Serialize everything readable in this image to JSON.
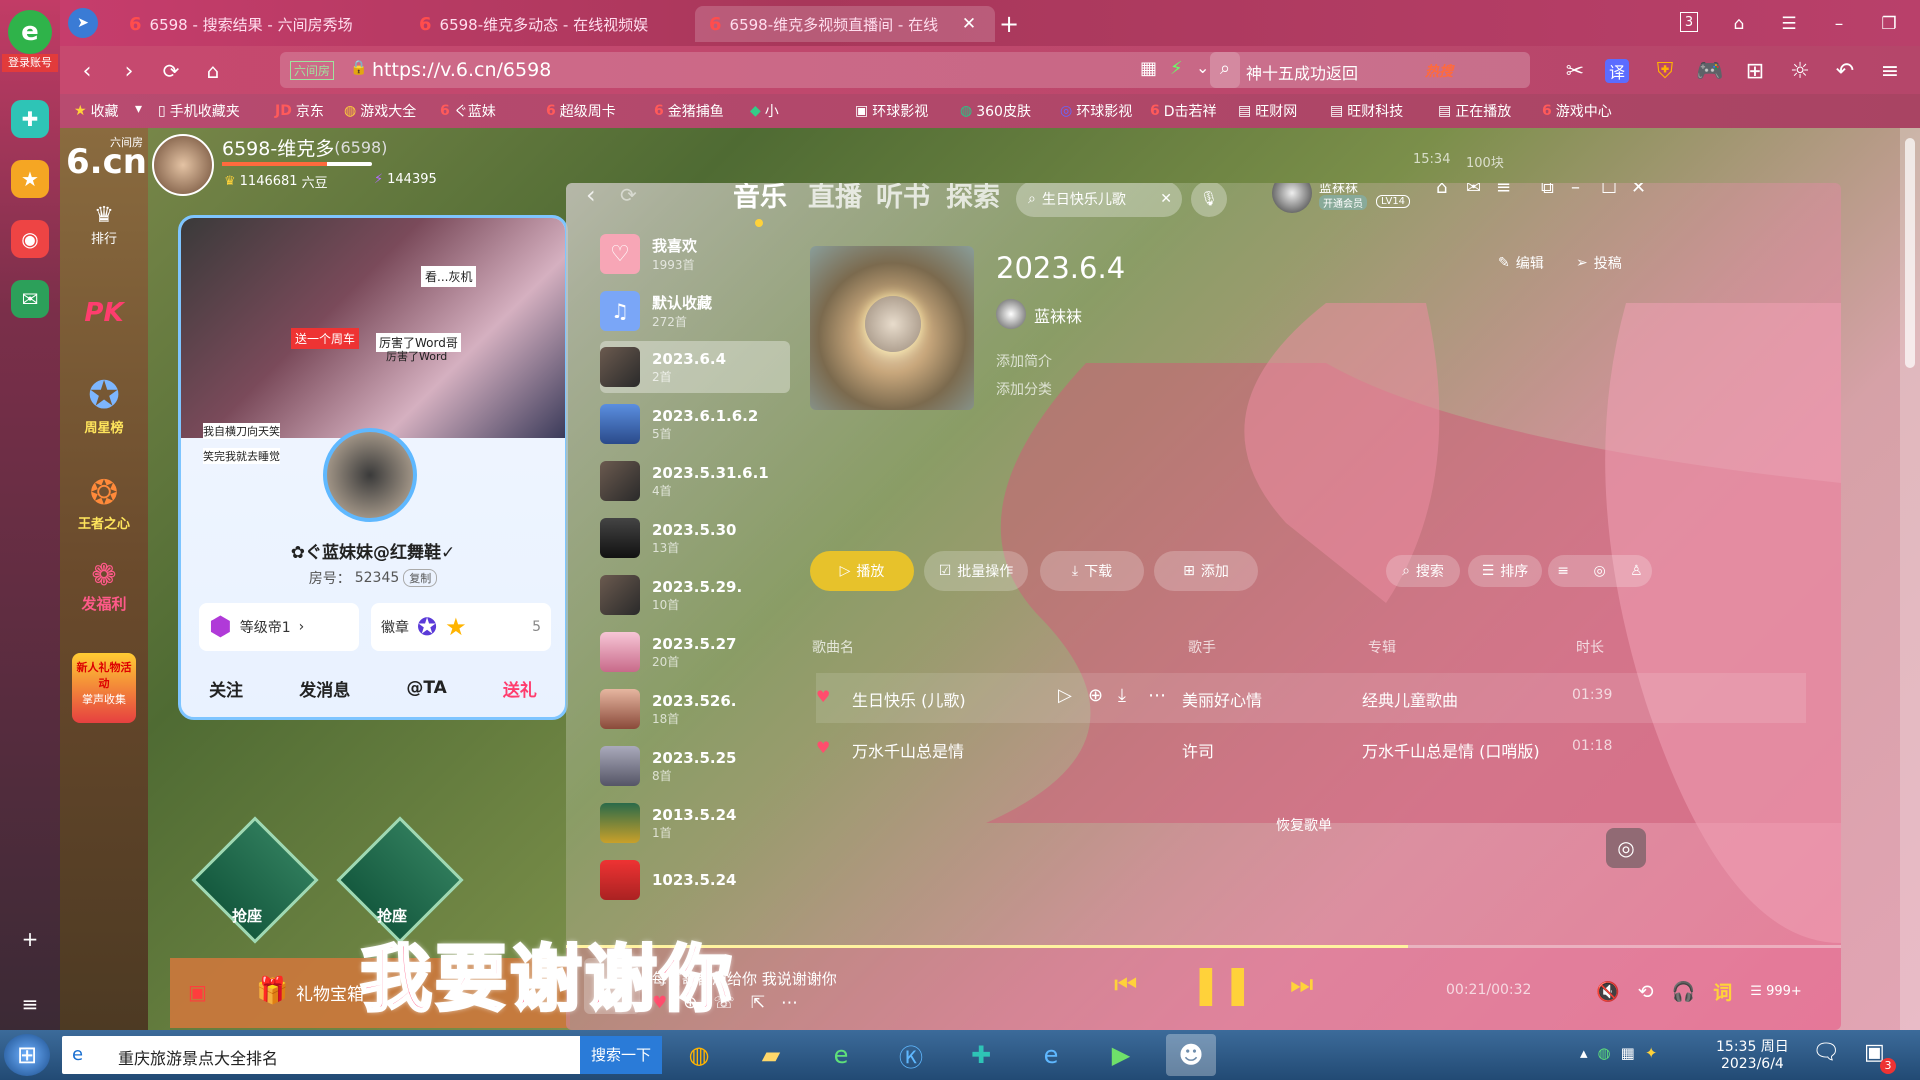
{
  "browser": {
    "login_label": "登录账号",
    "tabs": [
      {
        "label": "6598 - 搜索结果 - 六间房秀场"
      },
      {
        "label": "6598-维克多动态 - 在线视频娱"
      },
      {
        "label": "6598-维克多视频直播间 - 在线"
      }
    ],
    "tab_count": "3",
    "site_label": "六间房",
    "url": "https://v.6.cn/6598",
    "search_text": "神十五成功返回",
    "search_hot": "热搜",
    "bookmarks": [
      "收藏",
      "手机收藏夹",
      "京东",
      "游戏大全",
      "ぐ蓝妹",
      "超级周卡",
      "金猪捕鱼",
      "小",
      "环球影视",
      "360皮肤",
      "环球影视",
      "D击若祥",
      "旺财网",
      "旺财科技",
      "正在播放",
      "游戏中心"
    ]
  },
  "site": {
    "logo_sub": "六间房",
    "logo_main": "6.cn",
    "side_items": [
      "排行",
      "PK",
      "周星榜",
      "王者之心",
      "发福利",
      "新人礼物活动",
      "掌声收集"
    ],
    "host_name": "6598-维克多",
    "host_id": "(6598)",
    "beans": "1146681",
    "beans_unit": "六豆",
    "fans": "144395",
    "panel_overlay_text": [
      "看...灰机",
      "送一个周车",
      "厉害了Word哥",
      "厉害了Word",
      "我自横刀向天笑",
      "笑完我就去睡觉"
    ],
    "anchor_name": "✿ぐ蓝妹妹@红舞鞋✓",
    "room_label": "房号：",
    "room_no": "52345",
    "copy_label": "复制",
    "level_label": "等级帝1",
    "badge_label": "徽章",
    "badge_count": "5",
    "actions": [
      "关注",
      "发消息",
      "@TA",
      "送礼"
    ],
    "seat_label": "抢座",
    "gift_label": "礼物宝箱"
  },
  "music": {
    "nav_tabs": [
      "音乐",
      "直播",
      "听书",
      "探索"
    ],
    "search_value": "生日快乐儿歌",
    "user_name": "蓝袜袜",
    "vip_label": "开通会员",
    "level": "LV14",
    "playlists": [
      {
        "name": "我喜欢",
        "count": "1993首"
      },
      {
        "name": "默认收藏",
        "count": "272首"
      },
      {
        "name": "2023.6.4",
        "count": "2首"
      },
      {
        "name": "2023.6.1.6.2",
        "count": "5首"
      },
      {
        "name": "2023.5.31.6.1",
        "count": "4首"
      },
      {
        "name": "2023.5.30",
        "count": "13首"
      },
      {
        "name": "2023.5.29.",
        "count": "10首"
      },
      {
        "name": "2023.5.27",
        "count": "20首"
      },
      {
        "name": "2023.526.",
        "count": "18首"
      },
      {
        "name": "2023.5.25",
        "count": "8首"
      },
      {
        "name": "2013.5.24",
        "count": "1首"
      },
      {
        "name": "1023.5.24",
        "count": ""
      }
    ],
    "selected_title": "2023.6.4",
    "creator": "蓝袜袜",
    "add_intro": "添加简介",
    "add_category": "添加分类",
    "edit_label": "编辑",
    "submit_label": "投稿",
    "buttons": {
      "play": "播放",
      "batch": "批量操作",
      "download": "下载",
      "add": "添加",
      "search": "搜索",
      "sort": "排序"
    },
    "columns": {
      "song": "歌曲名",
      "artist": "歌手",
      "album": "专辑",
      "duration": "时长"
    },
    "tracks": [
      {
        "title": "生日快乐 (儿歌)",
        "artist": "美丽好心情",
        "album": "经典儿童歌曲",
        "duration": "01:39"
      },
      {
        "title": "万水千山总是情",
        "artist": "许司",
        "album": "万水千山总是情 (口哨版)",
        "duration": "01:18"
      }
    ],
    "restore_label": "恢复歌单",
    "now_playing": "每首歌都想给你 我说谢谢你",
    "time": "00:21/00:32",
    "progress": 0.66,
    "queue": "999+",
    "lyrics_char": "词",
    "clock_small": "15:34",
    "price_small": "100块"
  },
  "lyrics": "我要谢谢你",
  "taskbar": {
    "search_text": "重庆旅游景点大全排名",
    "search_button": "搜索一下",
    "time": "15:35 周日",
    "date": "2023/6/4",
    "notif_count": "3"
  },
  "colors": {
    "accent": "#c7496f",
    "yellow": "#e7c22b",
    "pink": "#ff3d6e"
  }
}
